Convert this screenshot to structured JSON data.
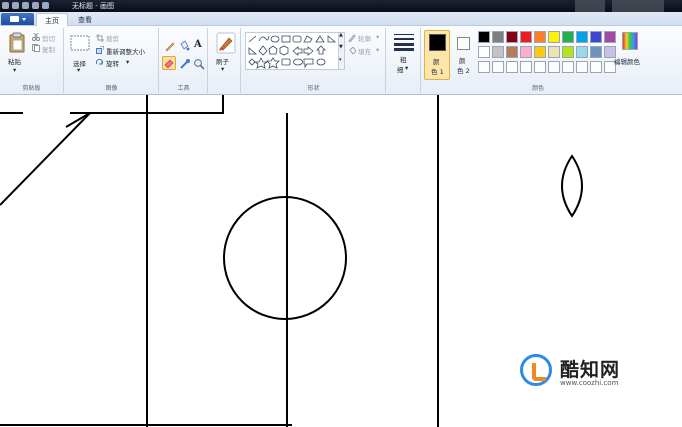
{
  "window": {
    "title": "无标题 - 画图"
  },
  "tabs": [
    {
      "label": "主页",
      "active": true
    },
    {
      "label": "查看",
      "active": false
    }
  ],
  "clipboard": {
    "paste": "粘贴",
    "cut": "剪切",
    "copy": "复制",
    "group": "剪贴板"
  },
  "image": {
    "select": "选择",
    "crop": "裁剪",
    "resize": "重新调整大小",
    "rotate": "旋转",
    "group": "图像"
  },
  "tools": {
    "group": "工具"
  },
  "brushes": {
    "label": "刷子"
  },
  "shapes": {
    "outline": "轮廓",
    "fill": "填充",
    "group": "形状"
  },
  "size": {
    "label_top": "粗",
    "label_bottom": "细"
  },
  "colors": {
    "color1_label_top": "颜",
    "color1_label_bottom": "色 1",
    "color2_label_top": "颜",
    "color2_label_bottom": "色 2",
    "edit": "编辑颜色",
    "group": "颜色",
    "color1": "#000000",
    "color2": "#ffffff",
    "palette_row1": [
      "#000000",
      "#7f7f7f",
      "#880015",
      "#ed1c24",
      "#ff7f27",
      "#fff200",
      "#22b14c",
      "#00a2e8",
      "#3f48cc",
      "#a349a4"
    ],
    "palette_row2": [
      "#ffffff",
      "#c3c3c3",
      "#b97a57",
      "#ffaec9",
      "#ffc90e",
      "#efe4b0",
      "#b5e61d",
      "#99d9ea",
      "#7092be",
      "#c8bfe7"
    ]
  },
  "watermark": {
    "name": "酷知网",
    "url": "www.coozhi.com"
  }
}
